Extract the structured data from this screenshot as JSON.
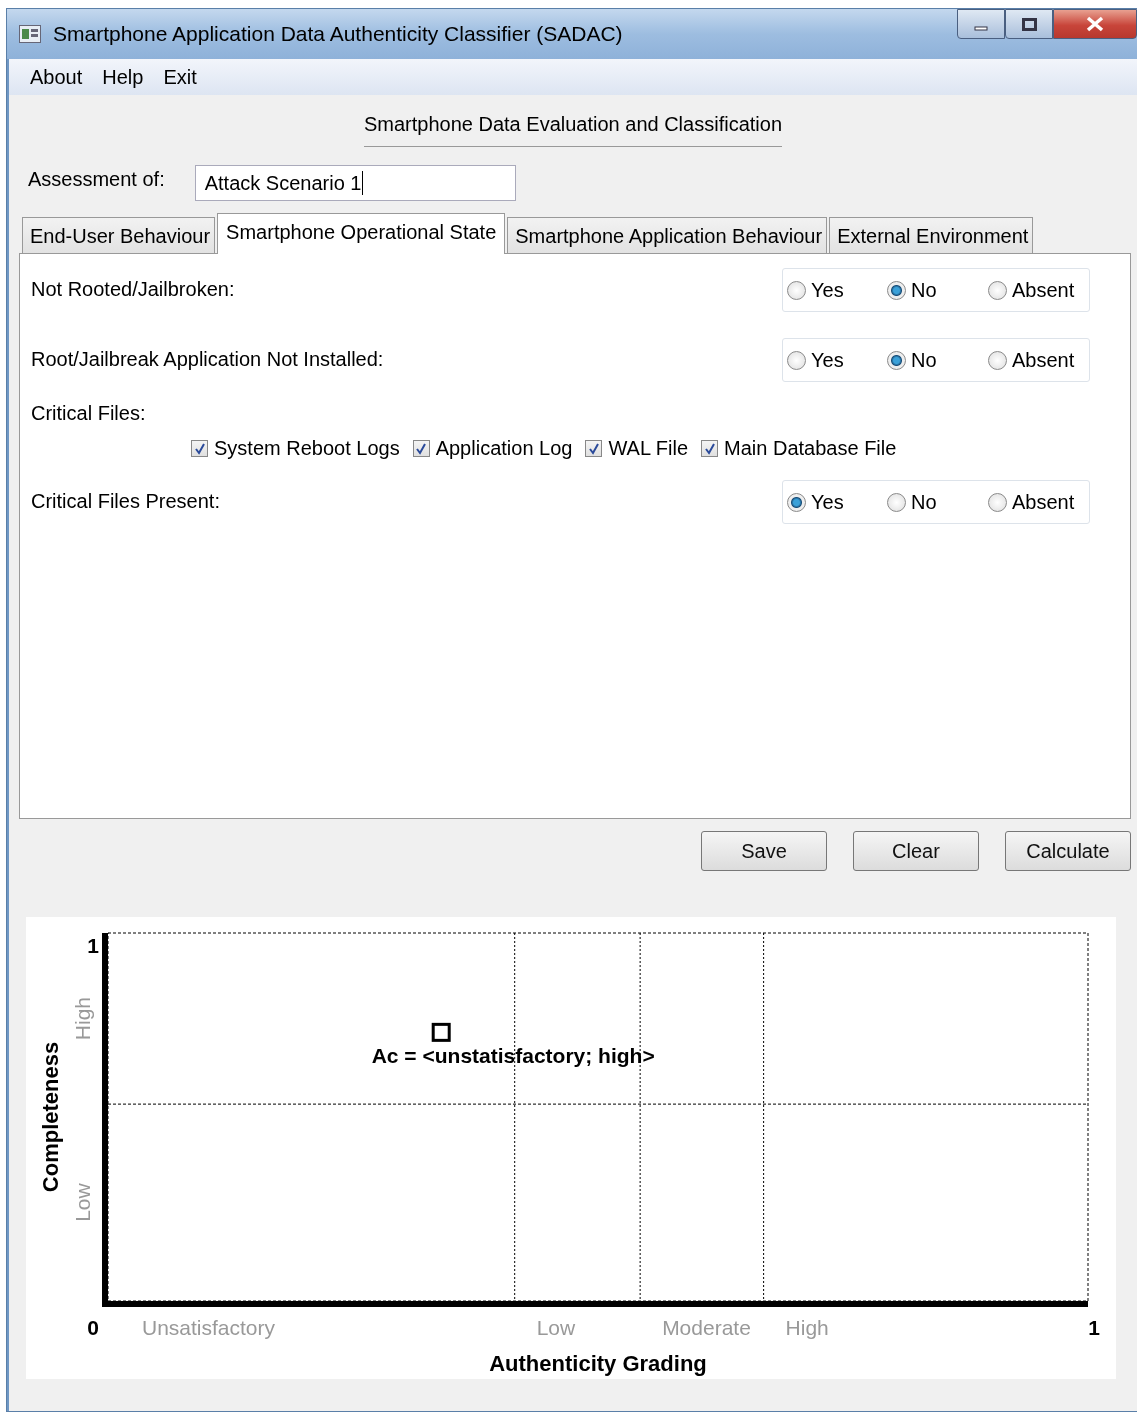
{
  "window": {
    "title": "Smartphone Application Data Authenticity Classifier (SADAC)"
  },
  "menu": [
    "About",
    "Help",
    "Exit"
  ],
  "heading": "Smartphone Data Evaluation and Classification",
  "assessment": {
    "label": "Assessment of:",
    "value": "Attack Scenario 1"
  },
  "tabs": [
    {
      "label": "End-User Behaviour",
      "selected": false
    },
    {
      "label": "Smartphone Operational State",
      "selected": true
    },
    {
      "label": "Smartphone Application Behaviour",
      "selected": false
    },
    {
      "label": "External Environment",
      "selected": false
    }
  ],
  "rows": [
    {
      "kind": "radio",
      "label": "Not Rooted/Jailbroken:",
      "options": [
        {
          "label": "Yes",
          "selected": false
        },
        {
          "label": "No",
          "selected": true
        },
        {
          "label": "Absent",
          "selected": false
        }
      ]
    },
    {
      "kind": "radio",
      "label": "Root/Jailbreak Application Not Installed:",
      "options": [
        {
          "label": "Yes",
          "selected": false
        },
        {
          "label": "No",
          "selected": true
        },
        {
          "label": "Absent",
          "selected": false
        }
      ]
    },
    {
      "kind": "checkboxes",
      "label": "Critical Files:",
      "options": [
        {
          "label": "System Reboot Logs",
          "checked": true
        },
        {
          "label": "Application Log",
          "checked": true
        },
        {
          "label": "WAL File",
          "checked": true
        },
        {
          "label": "Main Database File",
          "checked": true
        }
      ]
    },
    {
      "kind": "radio",
      "label": "Critical Files Present:",
      "options": [
        {
          "label": "Yes",
          "selected": true
        },
        {
          "label": "No",
          "selected": false
        },
        {
          "label": "Absent",
          "selected": false
        }
      ]
    }
  ],
  "buttons": [
    "Save",
    "Clear",
    "Calculate"
  ],
  "chart": {
    "x_axis_title": "Authenticity Grading",
    "y_axis_title": "Completeness",
    "y_end_label": "1",
    "origin_label": "0",
    "x_end_label": "1",
    "point_label": "Ac = <unstatisfactory; high>",
    "x_bands": [
      "Unsatisfactory",
      "Low",
      "Moderate",
      "High"
    ],
    "y_bands": [
      "Low",
      "High"
    ]
  }
}
